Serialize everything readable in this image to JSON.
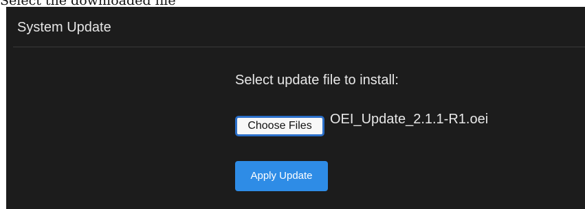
{
  "caption": "Select the downloaded file",
  "panel": {
    "title": "System Update",
    "prompt": "Select update file to install:",
    "file_button_label": "Choose Files",
    "selected_file": "OEI_Update_2.1.1-R1.oei",
    "apply_button_label": "Apply Update"
  },
  "colors": {
    "panel_background": "#1c1c1c",
    "accent": "#2e8ce6",
    "focus_ring": "#2b6fc9"
  }
}
